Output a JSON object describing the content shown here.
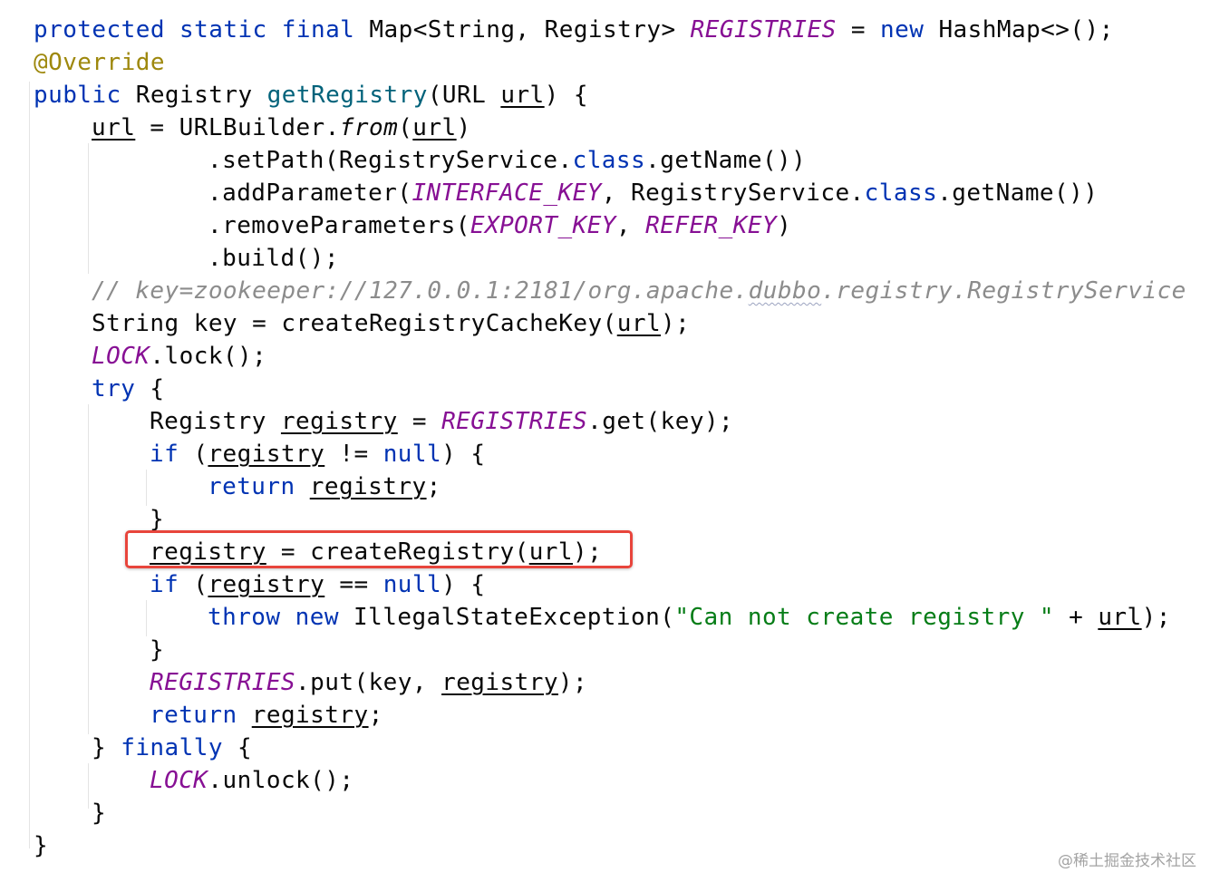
{
  "editor": {
    "colors": {
      "keyword": "#0033b3",
      "annotation": "#9e880d",
      "method_declaration": "#00627a",
      "static_field": "#871094",
      "string": "#067d17",
      "comment": "#8c8c8c",
      "default_text": "#080808",
      "highlight_box": "#e8453c"
    },
    "lines": {
      "l0": {
        "t0": "protected static final",
        "t1": " Map<String, Registry> ",
        "t2": "REGISTRIES",
        "t3": " = ",
        "t4": "new",
        "t5": " HashMap<>();"
      },
      "l1": {
        "t0": "@Override"
      },
      "l2": {
        "t0": "public",
        "t1": " Registry ",
        "t2": "getRegistry",
        "t3": "(URL ",
        "t4": "url",
        "t5": ") {"
      },
      "l3": {
        "t0": "url",
        "t1": " = URLBuilder.",
        "t2": "from",
        "t3": "(",
        "t4": "url",
        "t5": ")"
      },
      "l4": {
        "t0": ".setPath(RegistryService.",
        "t1": "class",
        "t2": ".getName())"
      },
      "l5": {
        "t0": ".addParameter(",
        "t1": "INTERFACE_KEY",
        "t2": ", RegistryService.",
        "t3": "class",
        "t4": ".getName())"
      },
      "l6": {
        "t0": ".removeParameters(",
        "t1": "EXPORT_KEY",
        "t2": ", ",
        "t3": "REFER_KEY",
        "t4": ")"
      },
      "l7": {
        "t0": ".build();"
      },
      "l8": {
        "t0": "// key=zookeeper://127.0.0.1:2181/org.apache.",
        "t1": "dubbo",
        "t2": ".registry.RegistryService"
      },
      "l9": {
        "t0": "String key = createRegistryCacheKey(",
        "t1": "url",
        "t2": ");"
      },
      "l10": {
        "t0": "LOCK",
        "t1": ".lock();"
      },
      "l11": {
        "t0": "try",
        "t1": " {"
      },
      "l12": {
        "t0": "Registry ",
        "t1": "registry",
        "t2": " = ",
        "t3": "REGISTRIES",
        "t4": ".get(key);"
      },
      "l13": {
        "t0": "if",
        "t1": " (",
        "t2": "registry",
        "t3": " != ",
        "t4": "null",
        "t5": ") {"
      },
      "l14": {
        "t0": "return",
        "t1": " ",
        "t2": "registry",
        "t3": ";"
      },
      "l15": {
        "t0": "}"
      },
      "l16": {
        "t0": "registry",
        "t1": " = createRegistry(",
        "t2": "url",
        "t3": ");"
      },
      "l17": {
        "t0": "if",
        "t1": " (",
        "t2": "registry",
        "t3": " == ",
        "t4": "null",
        "t5": ") {"
      },
      "l18": {
        "t0": "throw new",
        "t1": " IllegalStateException(",
        "t2": "\"Can not create registry \"",
        "t3": " + ",
        "t4": "url",
        "t5": ");"
      },
      "l19": {
        "t0": "}"
      },
      "l20": {
        "t0": "REGISTRIES",
        "t1": ".put(key, ",
        "t2": "registry",
        "t3": ");"
      },
      "l21": {
        "t0": "return",
        "t1": " ",
        "t2": "registry",
        "t3": ";"
      },
      "l22": {
        "t0": "} ",
        "t1": "finally",
        "t2": " {"
      },
      "l23": {
        "t0": "LOCK",
        "t1": ".unlock();"
      },
      "l24": {
        "t0": "}"
      },
      "l25": {
        "t0": "}"
      }
    }
  },
  "watermark": {
    "text": "@稀土掘金技术社区"
  }
}
